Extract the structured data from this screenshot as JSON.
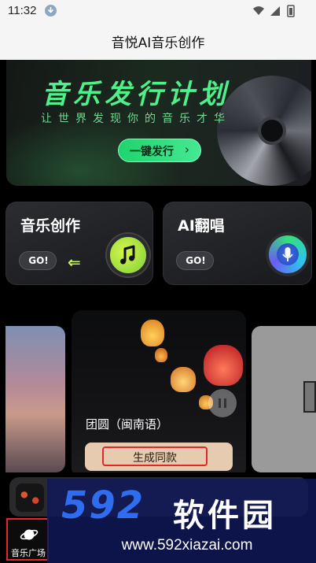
{
  "status_bar": {
    "time": "11:32"
  },
  "header": {
    "title": "音悦AI音乐创作"
  },
  "banner": {
    "title": "音乐发行计划",
    "subtitle": "让世界发现你的音乐才华",
    "button_label": "一键发行",
    "button_arrow": "›"
  },
  "features": [
    {
      "title": "音乐创作",
      "go_label": "GO!",
      "arrow": "⇐",
      "icon": "music-note-icon"
    },
    {
      "title": "AI翻唱",
      "go_label": "GO!",
      "icon": "microphone-icon"
    }
  ],
  "carousel": {
    "current": {
      "title": "团圆（闽南语）",
      "button_label": "生成同款"
    }
  },
  "bottom_nav": {
    "active_tab_label": "音乐广场"
  },
  "watermark": {
    "logo": "592",
    "logo_cn": "软件园",
    "url": "www.592xiazai.com"
  },
  "colors": {
    "accent_green": "#4ef08a",
    "highlight_red": "#e0282a",
    "generate_button_bg": "#e6cbb0"
  }
}
